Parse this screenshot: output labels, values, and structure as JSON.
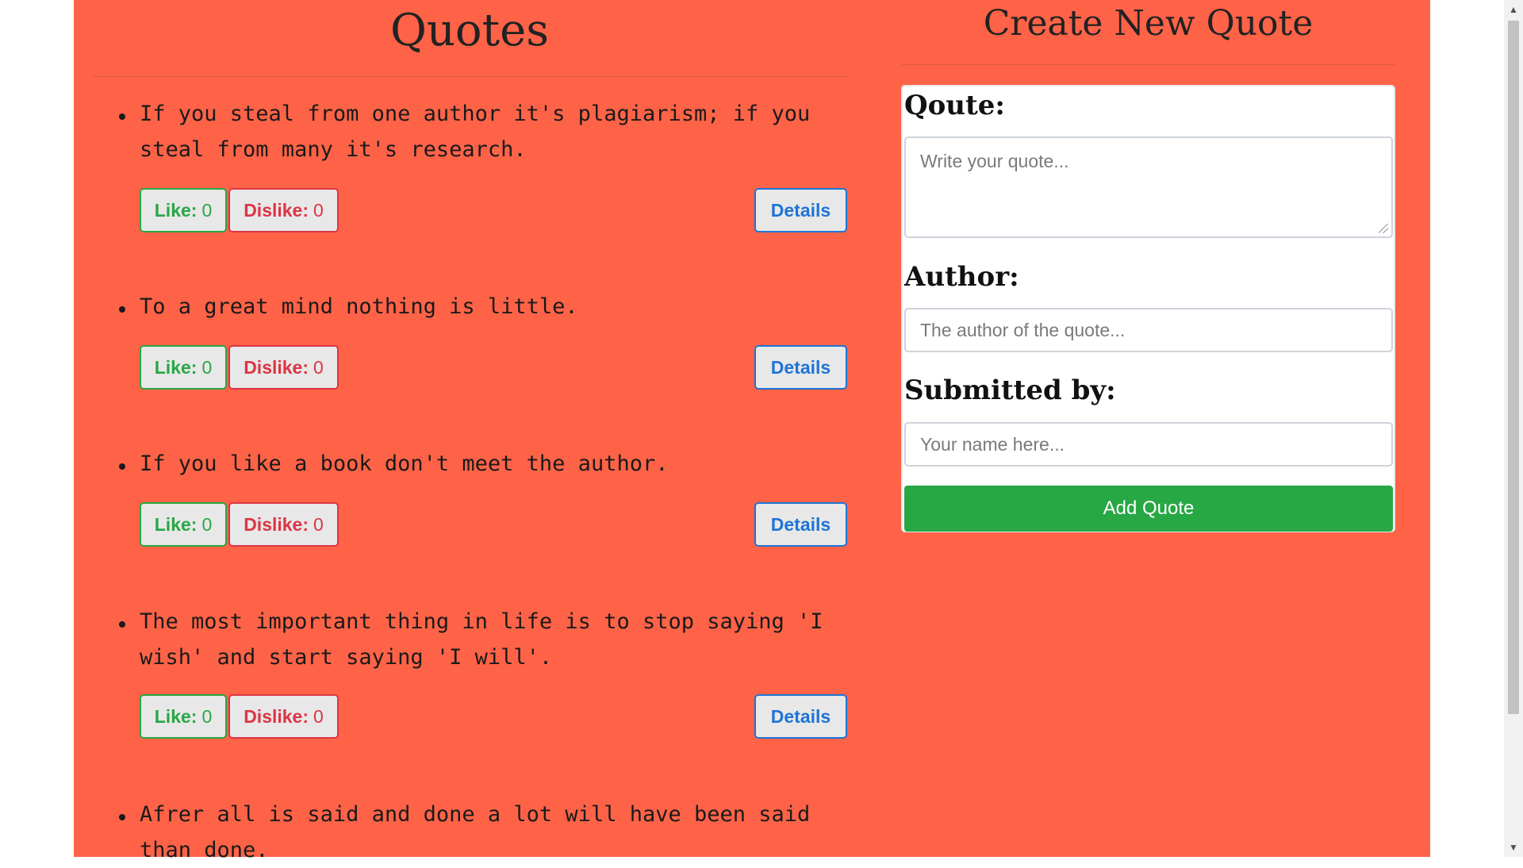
{
  "quotes_section": {
    "title": "Quotes",
    "items": [
      {
        "text": "If you steal from one author it's plagiarism; if you steal from many it's research.",
        "like_label": "Like:",
        "like_count": "0",
        "dislike_label": "Dislike:",
        "dislike_count": "0",
        "details_label": "Details"
      },
      {
        "text": "To a great mind nothing is little.",
        "like_label": "Like:",
        "like_count": "0",
        "dislike_label": "Dislike:",
        "dislike_count": "0",
        "details_label": "Details"
      },
      {
        "text": "If you like a book don't meet the author.",
        "like_label": "Like:",
        "like_count": "0",
        "dislike_label": "Dislike:",
        "dislike_count": "0",
        "details_label": "Details"
      },
      {
        "text": "The most important thing in life is to stop saying 'I wish' and start saying 'I will'.",
        "like_label": "Like:",
        "like_count": "0",
        "dislike_label": "Dislike:",
        "dislike_count": "0",
        "details_label": "Details"
      },
      {
        "text": "Afrer all is said and done a lot will have been said than done."
      }
    ]
  },
  "create_form": {
    "title": "Create New Quote",
    "quote_label": "Qoute:",
    "quote_placeholder": "Write your quote...",
    "author_label": "Author:",
    "author_placeholder": "The author of the quote...",
    "submitted_label": "Submitted by:",
    "submitted_placeholder": "Your name here...",
    "submit_label": "Add Quote"
  },
  "colors": {
    "background": "#ff6347",
    "like": "#28a745",
    "dislike": "#dc3545",
    "details": "#1e74d8",
    "submit": "#28a745"
  }
}
